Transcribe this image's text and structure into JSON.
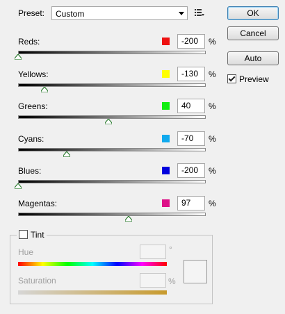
{
  "preset": {
    "label": "Preset:",
    "value": "Custom",
    "menu_icon": "list-menu-icon"
  },
  "buttons": {
    "ok": "OK",
    "cancel": "Cancel",
    "auto": "Auto"
  },
  "preview": {
    "label": "Preview",
    "checked": true
  },
  "unit": "%",
  "channels": [
    {
      "name": "Reds:",
      "value": "-200",
      "color": "#ee1111",
      "level": 0.0
    },
    {
      "name": "Yellows:",
      "value": "-130",
      "color": "#ffff00",
      "level": 0.14
    },
    {
      "name": "Greens:",
      "value": "40",
      "color": "#11ee11",
      "level": 0.48
    },
    {
      "name": "Cyans:",
      "value": "-70",
      "color": "#11aaee",
      "level": 0.26
    },
    {
      "name": "Blues:",
      "value": "-200",
      "color": "#0000dd",
      "level": 0.0
    },
    {
      "name": "Magentas:",
      "value": "97",
      "color": "#dd1188",
      "level": 0.59
    }
  ],
  "tint": {
    "label": "Tint",
    "checked": false,
    "hue_label": "Hue",
    "hue_unit": "°",
    "saturation_label": "Saturation",
    "saturation_unit": "%"
  }
}
